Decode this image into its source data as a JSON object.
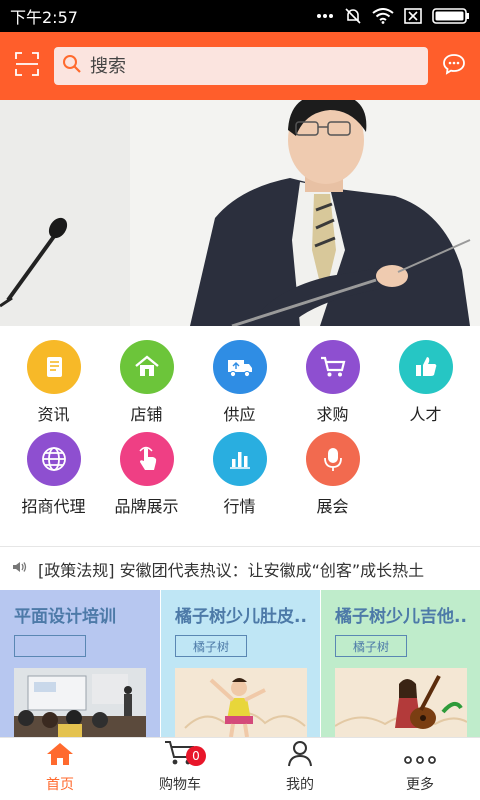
{
  "status_bar": {
    "time": "下午2:57"
  },
  "search": {
    "placeholder": "搜索"
  },
  "categories": [
    {
      "label": "资讯",
      "icon": "document-icon",
      "color": "#f7b928"
    },
    {
      "label": "店铺",
      "icon": "home-icon",
      "color": "#6cc53a"
    },
    {
      "label": "供应",
      "icon": "truck-icon",
      "color": "#2f8de4"
    },
    {
      "label": "求购",
      "icon": "cart-icon",
      "color": "#8e4fd0"
    },
    {
      "label": "人才",
      "icon": "thumbs-up-icon",
      "color": "#26c6c4"
    },
    {
      "label": "招商代理",
      "icon": "globe-icon",
      "color": "#8e4fd0"
    },
    {
      "label": "品牌展示",
      "icon": "tap-icon",
      "color": "#ef3f84"
    },
    {
      "label": "行情",
      "icon": "bar-chart-icon",
      "color": "#29aee0"
    },
    {
      "label": "展会",
      "icon": "microphone-icon",
      "color": "#f26a4f"
    }
  ],
  "news": {
    "text": "[政策法规] 安徽团代表热议：让安徽成“创客”成长热土"
  },
  "promos": [
    {
      "title": "平面设计培训",
      "tag": "",
      "bg": "#b7c7f0"
    },
    {
      "title": "橘子树少儿肚皮...",
      "tag": "橘子树",
      "bg": "#bfe6f5"
    },
    {
      "title": "橘子树少儿吉他...",
      "tag": "橘子树",
      "bg": "#bfeccb"
    }
  ],
  "tabbar": {
    "home": "首页",
    "cart": "购物车",
    "cart_badge": "0",
    "mine": "我的",
    "more": "更多"
  },
  "colors": {
    "brand": "#ff5e2b",
    "active_tab": "#ff6a2e"
  }
}
